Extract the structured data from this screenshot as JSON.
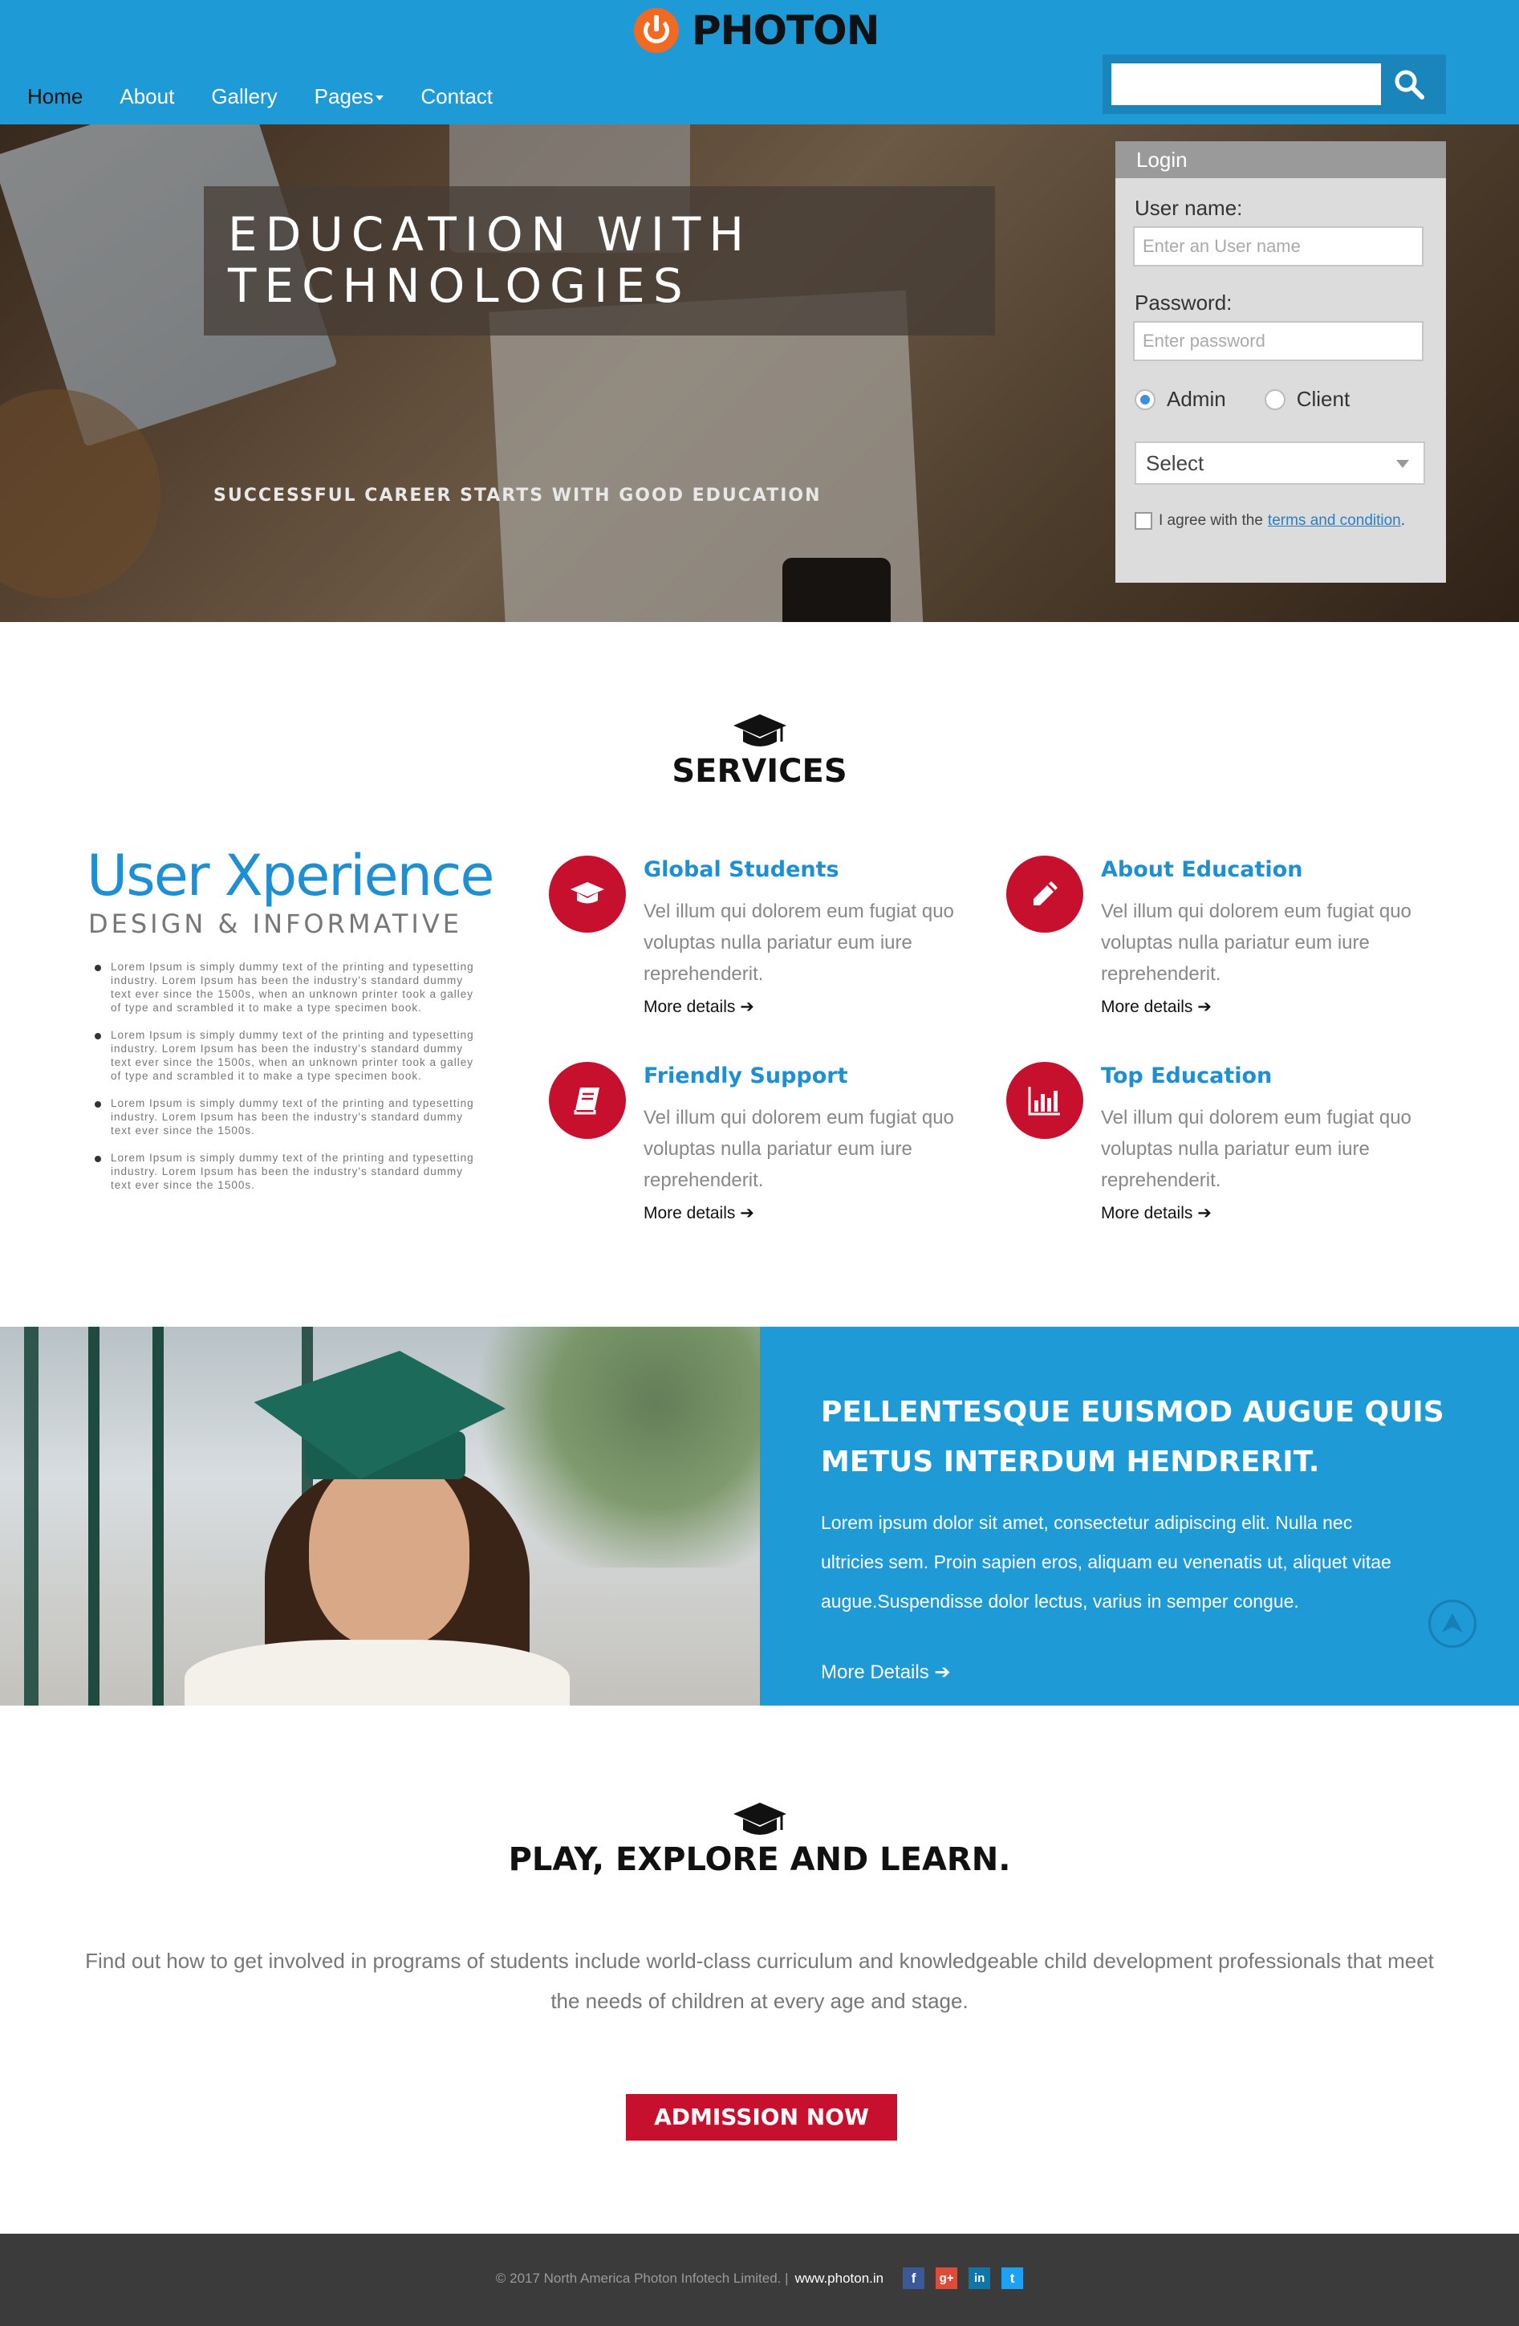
{
  "header": {
    "logo_text": "PHOTON",
    "nav": [
      {
        "label": "Home"
      },
      {
        "label": "About"
      },
      {
        "label": "Gallery"
      },
      {
        "label": "Pages"
      },
      {
        "label": "Contact"
      }
    ],
    "search_placeholder": ""
  },
  "hero": {
    "title_line1": "EDUCATION WITH",
    "title_line2": "TECHNOLOGIES",
    "subtitle": "SUCCESSFUL CAREER STARTS WITH GOOD EDUCATION"
  },
  "login": {
    "heading": "Login",
    "username_label": "User name:",
    "username_placeholder": "Enter an User name",
    "password_label": "Password:",
    "password_placeholder": "Enter password",
    "radio_admin": "Admin",
    "radio_client": "Client",
    "select_value": "Select",
    "agree_text": "I agree with the",
    "agree_link": "terms and condition",
    "agree_period": "."
  },
  "services": {
    "heading": "SERVICES",
    "ux_title": "User Xperience",
    "ux_subtitle": "DESIGN & INFORMATIVE",
    "ux_list": [
      "Lorem Ipsum is simply dummy text of the printing and typesetting industry. Lorem Ipsum has been the industry's standard dummy text ever since the 1500s, when an unknown printer took a galley of type and scrambled it to make a type specimen book.",
      "Lorem Ipsum is simply dummy text of the printing and typesetting industry. Lorem Ipsum has been the industry's standard dummy text ever since the 1500s, when an unknown printer took a galley of type and scrambled it to make a type specimen book.",
      "Lorem Ipsum is simply dummy text of the printing and typesetting industry. Lorem Ipsum has been the industry's standard dummy text ever since the 1500s.",
      "Lorem Ipsum is simply dummy text of the printing and typesetting industry. Lorem Ipsum has been the industry's standard dummy text ever since the 1500s."
    ],
    "items": [
      {
        "title": "Global Students",
        "icon": "graduation-cap-icon",
        "text": "Vel illum qui dolorem eum fugiat quo voluptas nulla pariatur eum iure reprehenderit.",
        "more": "More details"
      },
      {
        "title": "About Education",
        "icon": "pencil-icon",
        "text": "Vel illum qui dolorem eum fugiat quo voluptas nulla pariatur eum iure reprehenderit.",
        "more": "More details"
      },
      {
        "title": "Friendly Support",
        "icon": "book-icon",
        "text": "Vel illum qui dolorem eum fugiat quo voluptas nulla pariatur eum iure reprehenderit.",
        "more": "More details"
      },
      {
        "title": "Top Education",
        "icon": "bar-chart-icon",
        "text": "Vel illum qui dolorem eum fugiat quo voluptas nulla pariatur eum iure reprehenderit.",
        "more": "More details"
      }
    ]
  },
  "feature": {
    "title": "PELLENTESQUE EUISMOD AUGUE QUIS METUS INTERDUM HENDRERIT.",
    "text": "Lorem ipsum dolor sit amet, consectetur adipiscing elit. Nulla nec ultricies sem. Proin sapien eros, aliquam eu venenatis ut, aliquet vitae augue.Suspendisse dolor lectus, varius in semper congue.",
    "more": "More Details"
  },
  "play": {
    "heading": "PLAY, EXPLORE AND LEARN.",
    "text": "Find out how to get involved in programs of students include world-class curriculum and knowledgeable child development professionals that meet the needs of children at every age and stage.",
    "button": "ADMISSION NOW"
  },
  "footer": {
    "copyright": "© 2017 North America Photon Infotech Limited. |",
    "site": "www.photon.in",
    "social": [
      {
        "icon": "facebook-icon",
        "glyph": "f",
        "color": "#3b5998"
      },
      {
        "icon": "google-plus-icon",
        "glyph": "g+",
        "color": "#dd4b39"
      },
      {
        "icon": "linkedin-icon",
        "glyph": "in",
        "color": "#0e76a8"
      },
      {
        "icon": "twitter-icon",
        "glyph": "t",
        "color": "#1da1f2"
      }
    ]
  },
  "colors": {
    "brand_blue": "#1e9ad6",
    "accent_red": "#c7102e",
    "logo_orange": "#f26a21",
    "footer_bg": "#3b3b3b"
  }
}
